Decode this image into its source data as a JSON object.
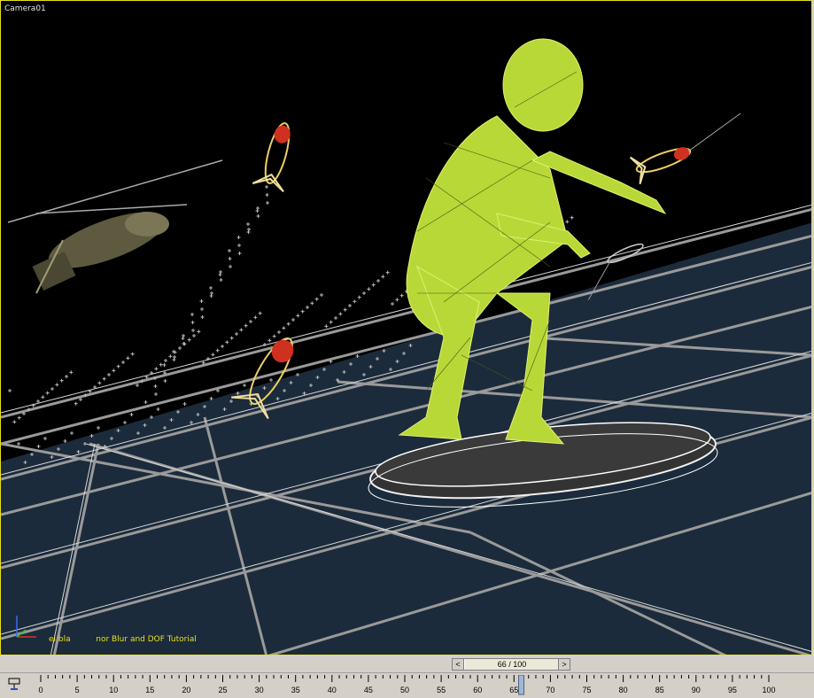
{
  "viewport": {
    "label": "Camera01",
    "overlay_text": "el bla          nor Blur and DOF Tutorial"
  },
  "time_slider": {
    "left_arrow": "<",
    "right_arrow": ">",
    "frame_display": "66 / 100",
    "current_frame": 66,
    "total_frames": 100
  },
  "timeline": {
    "tick_labels": [
      "0",
      "5",
      "10",
      "15",
      "20",
      "25",
      "30",
      "35",
      "40",
      "45",
      "50",
      "55",
      "60",
      "65",
      "70",
      "75",
      "80",
      "85",
      "90",
      "95",
      "100"
    ]
  },
  "colors": {
    "viewport_bg": "#000000",
    "viewport_border": "#e8e020",
    "wire_yellow": "#c8e830",
    "grid_gray": "#8a8a8a",
    "ground_dark": "#1a2a3a",
    "ui_gray": "#d4d0c8"
  },
  "icons": {
    "timeline_config": "key-mode-icon",
    "axis": "xyz-axis-icon"
  }
}
